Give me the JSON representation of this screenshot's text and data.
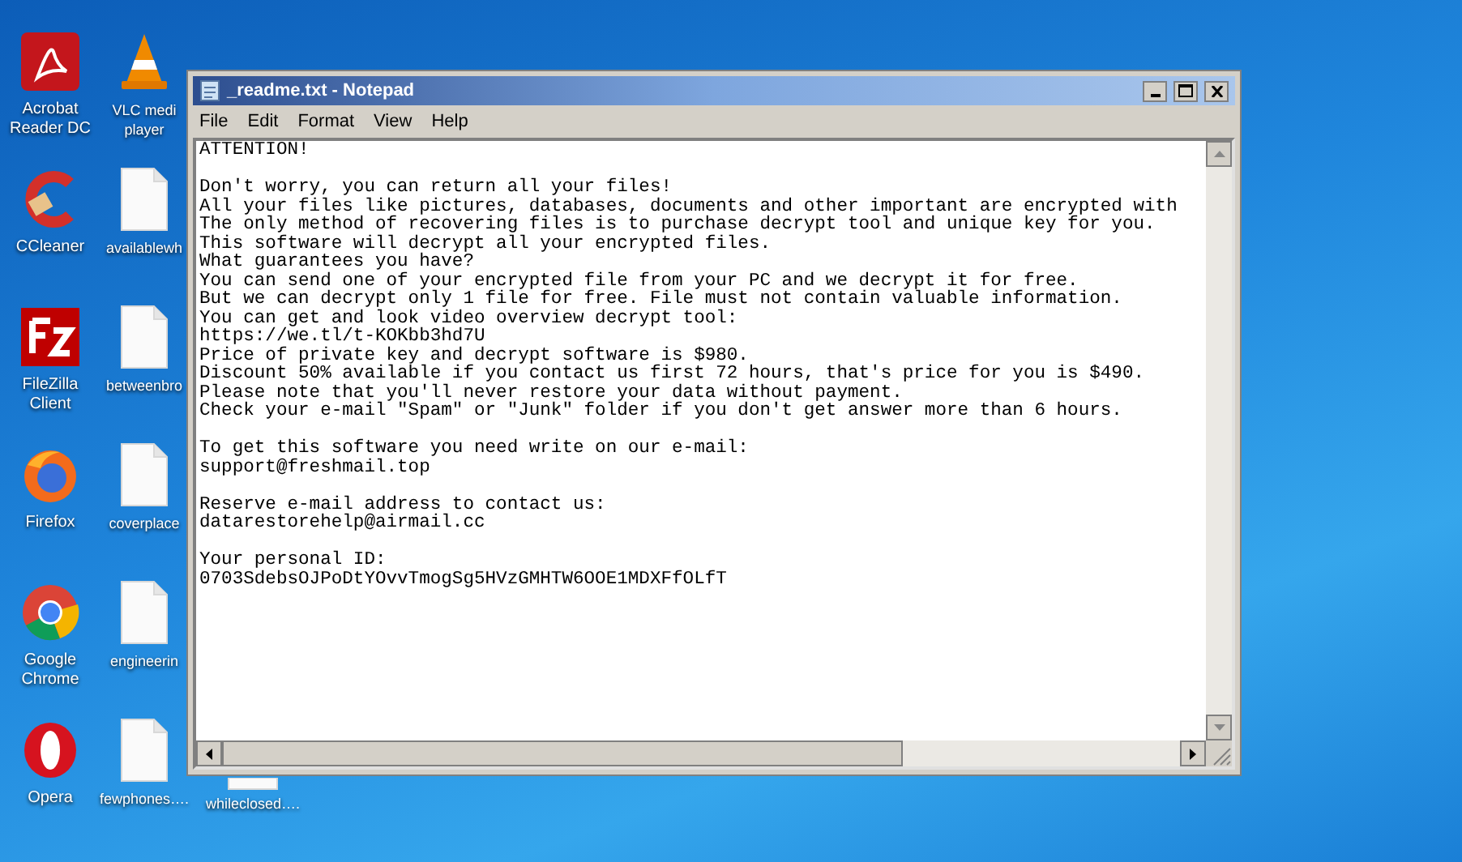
{
  "desktop_columns": [
    [
      {
        "label": "Acrobat Reader DC",
        "kind": "acrobat"
      },
      {
        "label": "CCleaner",
        "kind": "ccleaner"
      },
      {
        "label": "FileZilla Client",
        "kind": "filezilla"
      },
      {
        "label": "Firefox",
        "kind": "firefox"
      },
      {
        "label": "Google Chrome",
        "kind": "chrome"
      },
      {
        "label": "Opera",
        "kind": "opera"
      }
    ],
    [
      {
        "label": "VLC medi player",
        "kind": "vlc"
      },
      {
        "label": "availablewh",
        "kind": "file"
      },
      {
        "label": "betweenbro",
        "kind": "file"
      },
      {
        "label": "coverplace",
        "kind": "file"
      },
      {
        "label": "engineerin",
        "kind": "file"
      },
      {
        "label": "fewphones….",
        "kind": "file"
      }
    ],
    [
      {
        "label": "whileclosed….",
        "kind": "file-edge"
      }
    ]
  ],
  "window": {
    "title": "_readme.txt - Notepad",
    "menu": [
      "File",
      "Edit",
      "Format",
      "View",
      "Help"
    ],
    "paragraphs": [
      [
        "ATTENTION!"
      ],
      [
        "Don't worry, you can return all your files!",
        "All your files like pictures, databases, documents and other important are encrypted with",
        "The only method of recovering files is to purchase decrypt tool and unique key for you.",
        "This software will decrypt all your encrypted files.",
        "What guarantees you have?",
        "You can send one of your encrypted file from your PC and we decrypt it for free.",
        "But we can decrypt only 1 file for free. File must not contain valuable information.",
        "You can get and look video overview decrypt tool:",
        "https://we.tl/t-KOKbb3hd7U",
        "Price of private key and decrypt software is $980.",
        "Discount 50% available if you contact us first 72 hours, that's price for you is $490.",
        "Please note that you'll never restore your data without payment.",
        "Check your e-mail \"Spam\" or \"Junk\" folder if you don't get answer more than 6 hours."
      ],
      [
        "To get this software you need write on our e-mail:",
        "support@freshmail.top"
      ],
      [
        "Reserve e-mail address to contact us:",
        "datarestorehelp@airmail.cc"
      ],
      [
        "Your personal ID:",
        "0703SdebsOJPoDtYOvvTmogSg5HVzGMHTW6OOE1MDXFfOLfT"
      ]
    ]
  }
}
